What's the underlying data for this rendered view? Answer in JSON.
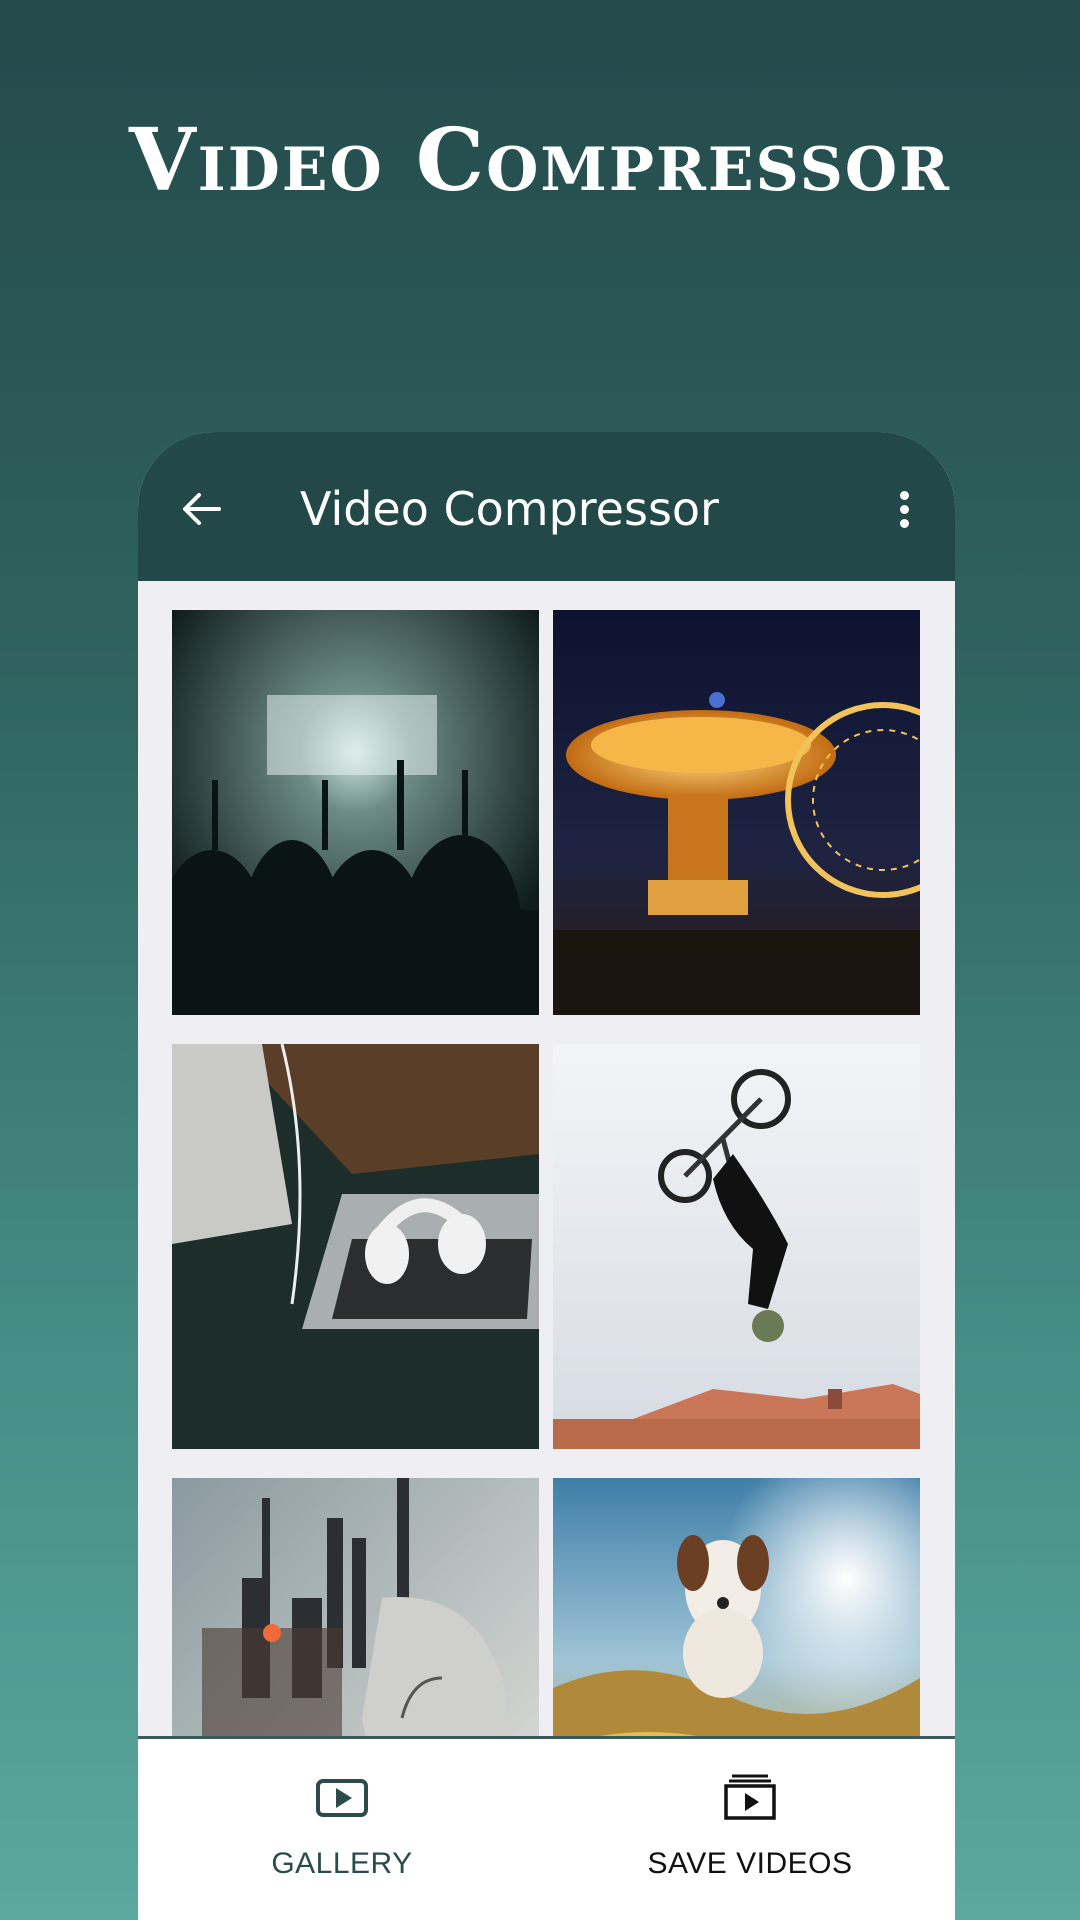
{
  "promo": {
    "title": "Video Compressor"
  },
  "appbar": {
    "title": "Video Compressor"
  },
  "grid": {
    "items": [
      {
        "name": "concert-crowd-thumbnail"
      },
      {
        "name": "carnival-ride-thumbnail"
      },
      {
        "name": "laptop-headphones-thumbnail"
      },
      {
        "name": "bmx-rider-thumbnail"
      },
      {
        "name": "city-portrait-thumbnail"
      },
      {
        "name": "dog-surfing-thumbnail"
      }
    ]
  },
  "bottom_nav": {
    "gallery_label": "GALLERY",
    "save_label": "SAVE VIDEOS"
  },
  "colors": {
    "appbar": "#224848",
    "accent": "#2c4c4c"
  },
  "icons": [
    "back-arrow-icon",
    "more-vert-icon",
    "video-play-icon",
    "video-stack-icon"
  ]
}
